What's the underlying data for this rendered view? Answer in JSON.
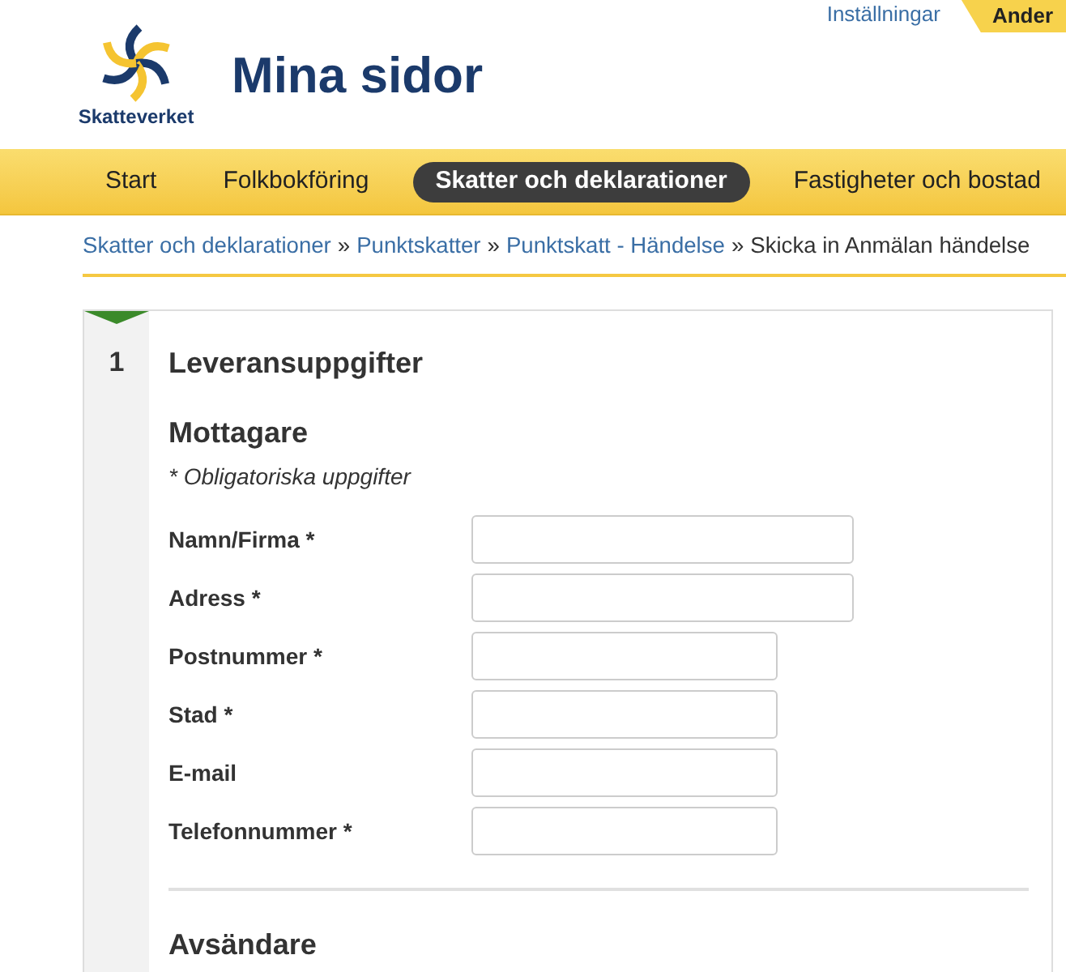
{
  "top_bar": {
    "links": [
      {
        "label": "Inställningar"
      }
    ],
    "user_tab": {
      "label": "Ander"
    }
  },
  "header": {
    "logo_text": "Skatteverket",
    "title": "Mina sidor"
  },
  "nav": {
    "items": [
      {
        "label": "Start",
        "selected": false
      },
      {
        "label": "Folkbokföring",
        "selected": false
      },
      {
        "label": "Skatter och deklarationer",
        "selected": true
      },
      {
        "label": "Fastigheter och bostad",
        "selected": false
      }
    ]
  },
  "breadcrumb": [
    {
      "kind": "link",
      "label": "Skatter och deklarationer"
    },
    {
      "kind": "separator",
      "label": "»"
    },
    {
      "kind": "link",
      "label": "Punktskatter"
    },
    {
      "kind": "separator",
      "label": "»"
    },
    {
      "kind": "link",
      "label": "Punktskatt - Händelse"
    },
    {
      "kind": "separator",
      "label": "»"
    },
    {
      "kind": "current",
      "label": "Skicka in Anmälan händelse"
    }
  ],
  "step": {
    "number": "1",
    "active": true,
    "title": "Leveransuppgifter",
    "sections": [
      {
        "heading": "Mottagare",
        "note": "* Obligatoriska uppgifter",
        "fields": [
          {
            "label": "Namn/Firma *",
            "kind": "long"
          },
          {
            "label": "Adress *",
            "kind": "long"
          },
          {
            "label": "Postnummer *",
            "kind": "short"
          },
          {
            "label": "Stad *",
            "kind": "short"
          },
          {
            "label": "E-mail",
            "kind": "short"
          },
          {
            "label": "Telefonnummer *",
            "kind": "short"
          }
        ]
      },
      {
        "heading": "Avsändare"
      }
    ]
  }
}
